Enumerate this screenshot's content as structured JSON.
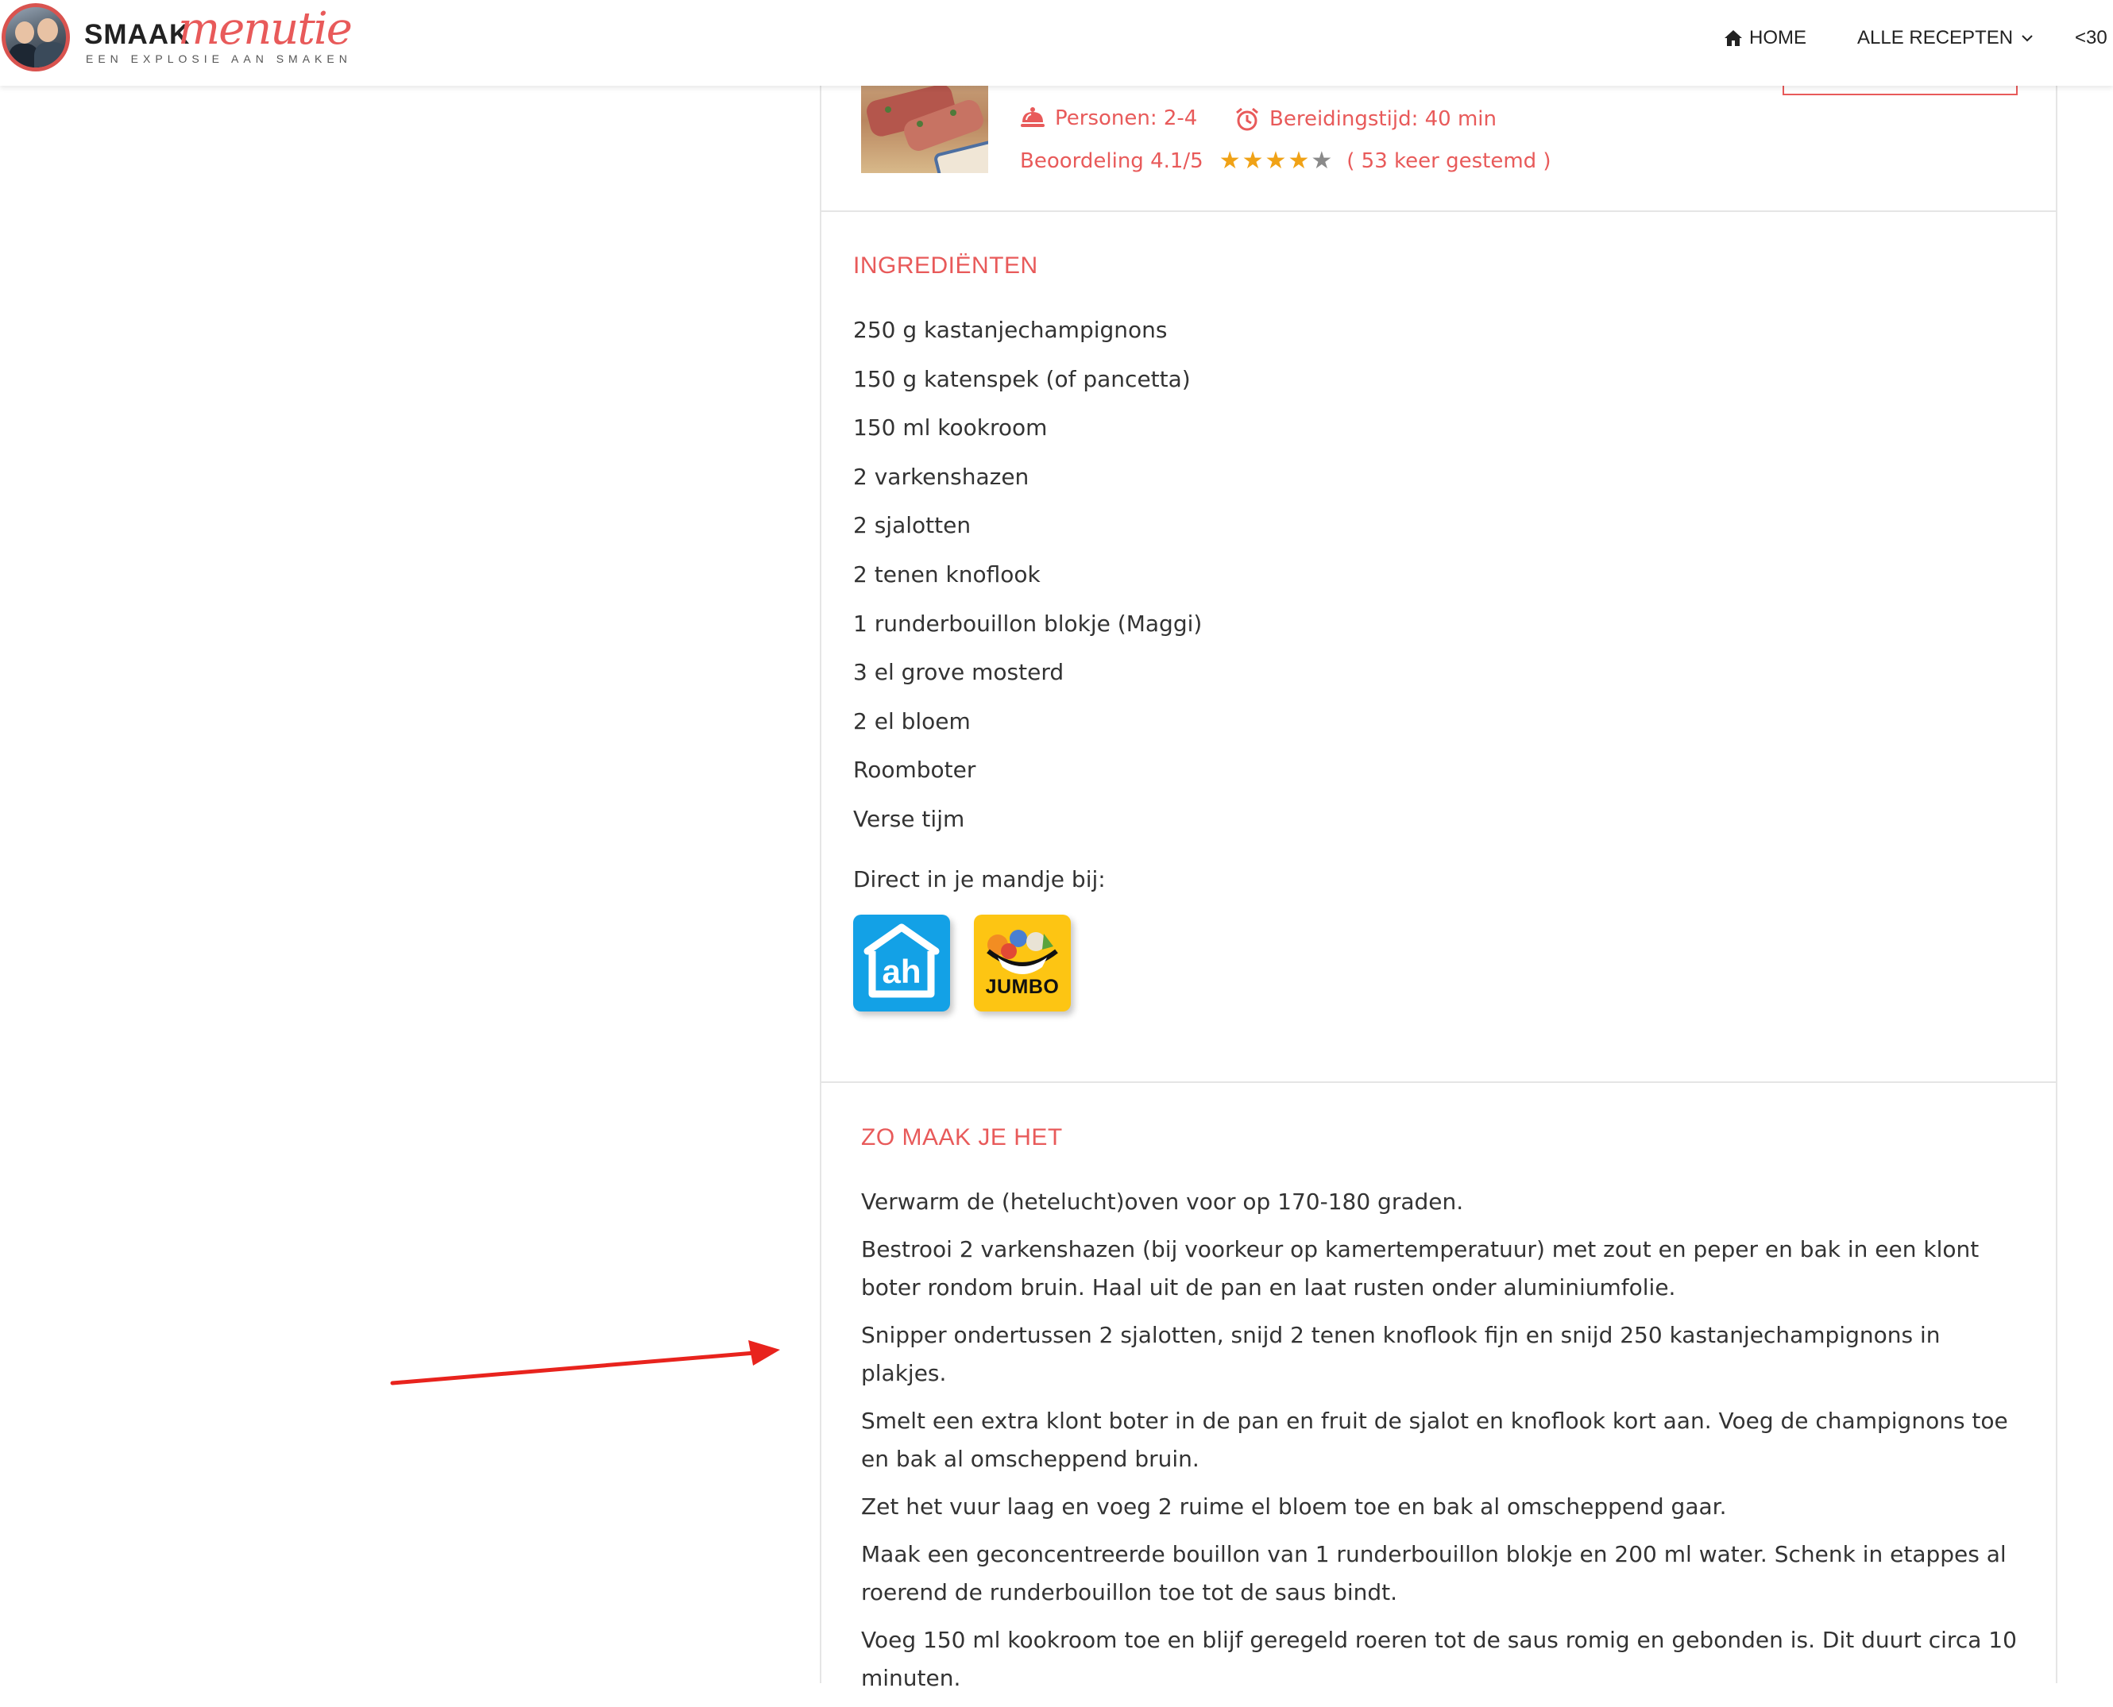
{
  "header": {
    "logo": {
      "brand_a": "SMAAK",
      "brand_b": "menutie",
      "tagline": "EEN EXPLOSIE AAN SMAKEN"
    },
    "nav": {
      "home": "HOME",
      "recipes": "ALLE RECEPTEN",
      "under30": "<30"
    }
  },
  "recipe": {
    "persons": "Personen: 2-4",
    "prep_time": "Bereidingstijd: 40 min",
    "rating": "Beoordeling 4.1/5",
    "stars_filled": 4,
    "stars_total": 5,
    "votes": "( 53 keer gestemd )"
  },
  "ingredients": {
    "title": "INGREDIËNTEN",
    "items": [
      "250 g kastanjechampignons",
      "150 g katenspek (of pancetta)",
      "150 ml kookroom",
      "2 varkenshazen",
      "2 sjalotten",
      "2 tenen knoflook",
      "1 runderbouillon blokje (Maggi)",
      "3 el grove mosterd",
      "2 el bloem",
      "Roomboter",
      "Verse tijm"
    ],
    "direct_label": "Direct in je mandje bij:",
    "shops": {
      "ah_logo": "ah",
      "jumbo_logo": "JUMBO"
    }
  },
  "directions": {
    "title": "ZO MAAK JE HET",
    "steps": [
      "Verwarm de (hetelucht)oven voor op 170-180 graden.",
      "Bestrooi 2 varkenshazen (bij voorkeur op kamertemperatuur) met zout en peper en bak in een klont boter rondom bruin. Haal uit de pan en laat rusten onder aluminiumfolie.",
      "Snipper ondertussen 2 sjalotten, snijd 2 tenen knoflook fijn en snijd 250 kastanjechampignons in plakjes.",
      "Smelt een extra klont boter in de pan en fruit de sjalot en knoflook kort aan. Voeg de champignons toe en bak al omscheppend bruin.",
      "Zet het vuur laag en voeg 2 ruime el bloem toe en bak al omscheppend gaar.",
      "Maak een geconcentreerde bouillon van 1 runderbouillon blokje en 200 ml water. Schenk in etappes al roerend de runderbouillon toe tot de saus bindt.",
      "Voeg 150 ml kookroom toe en blijf geregeld roeren tot de saus romig en gebonden is. Dit duurt circa 10 minuten."
    ]
  },
  "colors": {
    "accent": "#e85a5a",
    "star": "#f0a216",
    "ah_blue": "#13a1e6",
    "jumbo_yellow": "#fdc513",
    "annotation_arrow": "#e8231d"
  },
  "icons": {
    "home": "home-icon",
    "dropdown": "chevron-down-icon",
    "persons": "serving-dish-icon",
    "time": "alarm-clock-icon",
    "annotation": "red-arrow-icon"
  }
}
